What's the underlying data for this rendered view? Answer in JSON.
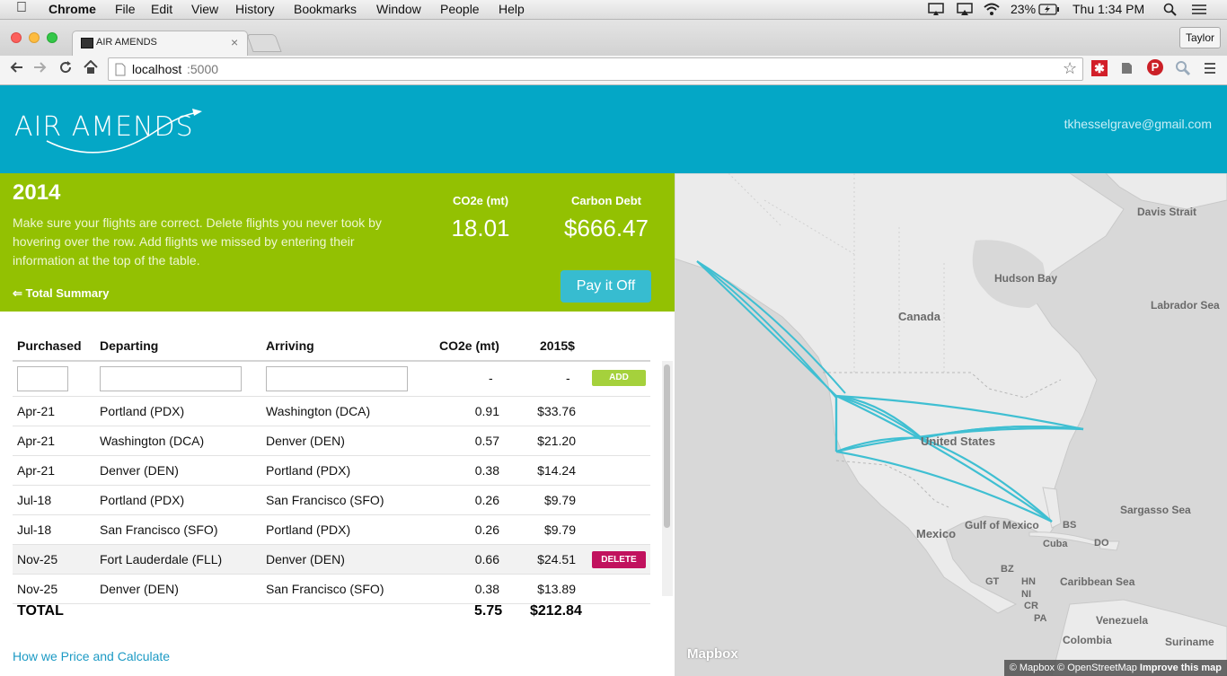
{
  "menubar": {
    "apple": "",
    "app": "Chrome",
    "items": [
      "File",
      "Edit",
      "View",
      "History",
      "Bookmarks",
      "Window",
      "People",
      "Help"
    ],
    "battery": "23%",
    "clock": "Thu 1:34 PM"
  },
  "browser": {
    "tab_title": "AIR AMENDS",
    "profile": "Taylor",
    "url_host": "localhost",
    "url_port": ":5000"
  },
  "header": {
    "logo": "AIR AMENDS",
    "email": "tkhesselgrave@gmail.com"
  },
  "summary": {
    "year": "2014",
    "intro": "Make sure your flights are correct. Delete flights you never took by hovering over the row. Add flights we missed by entering their information at the top of the table.",
    "back_link": "⇐ Total Summary",
    "co2_label": "CO2e (mt)",
    "co2_value": "18.01",
    "debt_label": "Carbon Debt",
    "debt_value": "$666.47",
    "pay_button": "Pay it Off"
  },
  "table": {
    "headers": [
      "Purchased",
      "Departing",
      "Arriving",
      "CO2e (mt)",
      "2015$"
    ],
    "entry_row": {
      "co2": "-",
      "cost": "-",
      "add_button": "ADD"
    },
    "rows": [
      {
        "purchased": "Apr-21",
        "departing": "Portland (PDX)",
        "arriving": "Washington (DCA)",
        "co2": "0.91",
        "cost": "$33.76"
      },
      {
        "purchased": "Apr-21",
        "departing": "Washington (DCA)",
        "arriving": "Denver (DEN)",
        "co2": "0.57",
        "cost": "$21.20"
      },
      {
        "purchased": "Apr-21",
        "departing": "Denver (DEN)",
        "arriving": "Portland (PDX)",
        "co2": "0.38",
        "cost": "$14.24"
      },
      {
        "purchased": "Jul-18",
        "departing": "Portland (PDX)",
        "arriving": "San Francisco (SFO)",
        "co2": "0.26",
        "cost": "$9.79"
      },
      {
        "purchased": "Jul-18",
        "departing": "San Francisco (SFO)",
        "arriving": "Portland (PDX)",
        "co2": "0.26",
        "cost": "$9.79"
      },
      {
        "purchased": "Nov-25",
        "departing": "Fort Lauderdale (FLL)",
        "arriving": "Denver (DEN)",
        "co2": "0.66",
        "cost": "$24.51"
      },
      {
        "purchased": "Nov-25",
        "departing": "Denver (DEN)",
        "arriving": "San Francisco (SFO)",
        "co2": "0.38",
        "cost": "$13.89"
      }
    ],
    "delete_button": "DELETE",
    "total_label": "TOTAL",
    "total_co2": "5.75",
    "total_cost": "$212.84"
  },
  "footer_link": "How we Price and Calculate",
  "map": {
    "labels": {
      "davis_strait": "Davis Strait",
      "hudson_bay": "Hudson Bay",
      "labrador_sea": "Labrador Sea",
      "canada": "Canada",
      "united_states": "United States",
      "sargasso_sea": "Sargasso Sea",
      "mexico": "Mexico",
      "gulf_of_mexico": "Gulf of Mexico",
      "bs": "BS",
      "cuba": "Cuba",
      "do": "DO",
      "bz": "BZ",
      "gt": "GT",
      "hn": "HN",
      "ni": "NI",
      "cr": "CR",
      "pa": "PA",
      "caribbean_sea": "Caribbean Sea",
      "venezuela": "Venezuela",
      "colombia": "Colombia",
      "suriname": "Suriname"
    },
    "watermark": "Mapbox",
    "attribution": "© Mapbox © OpenStreetMap",
    "improve": "Improve this map",
    "route_color": "#3fbfd2"
  },
  "colors": {
    "header_bg": "#04a7c6",
    "summary_bg": "#93c102",
    "pay_button": "#37bcd0",
    "delete_button": "#c1125e",
    "add_button": "#a5d13c",
    "link": "#1c9ac4"
  }
}
